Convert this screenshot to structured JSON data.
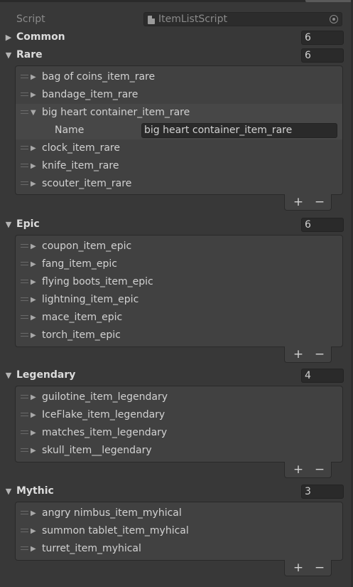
{
  "script_row": {
    "label": "Script",
    "value": "ItemListScript"
  },
  "sections": [
    {
      "name": "Common",
      "size": "6",
      "expanded": false,
      "items": []
    },
    {
      "name": "Rare",
      "size": "6",
      "expanded": true,
      "items": [
        {
          "label": "bag of coins_item_rare",
          "expanded": false
        },
        {
          "label": "bandage_item_rare",
          "expanded": false
        },
        {
          "label": "big heart container_item_rare",
          "expanded": true,
          "field_label": "Name",
          "field_value": "big heart container_item_rare"
        },
        {
          "label": "clock_item_rare",
          "expanded": false
        },
        {
          "label": "knife_item_rare",
          "expanded": false
        },
        {
          "label": "scouter_item_rare",
          "expanded": false
        }
      ]
    },
    {
      "name": "Epic",
      "size": "6",
      "expanded": true,
      "items": [
        {
          "label": "coupon_item_epic",
          "expanded": false
        },
        {
          "label": "fang_item_epic",
          "expanded": false
        },
        {
          "label": "flying boots_item_epic",
          "expanded": false
        },
        {
          "label": "lightning_item_epic",
          "expanded": false
        },
        {
          "label": "mace_item_epic",
          "expanded": false
        },
        {
          "label": "torch_item_epic",
          "expanded": false
        }
      ]
    },
    {
      "name": "Legendary",
      "size": "4",
      "expanded": true,
      "items": [
        {
          "label": "guilotine_item_legendary",
          "expanded": false
        },
        {
          "label": "IceFlake_item_legendary",
          "expanded": false
        },
        {
          "label": "matches_item_legendary",
          "expanded": false
        },
        {
          "label": "skull_item__legendary",
          "expanded": false
        }
      ]
    },
    {
      "name": "Mythic",
      "size": "3",
      "expanded": true,
      "items": [
        {
          "label": "angry nimbus_item_myhical",
          "expanded": false
        },
        {
          "label": "summon tablet_item_myhical",
          "expanded": false
        },
        {
          "label": "turret_item_myhical",
          "expanded": false
        }
      ]
    }
  ],
  "list_buttons": {
    "add": "+",
    "remove": "−"
  },
  "icons": {
    "collapsed": "▶",
    "expanded": "▼",
    "drag_handle": "drag-handle-icon",
    "script_file": "script-file-icon",
    "object_picker": "object-picker-icon"
  }
}
